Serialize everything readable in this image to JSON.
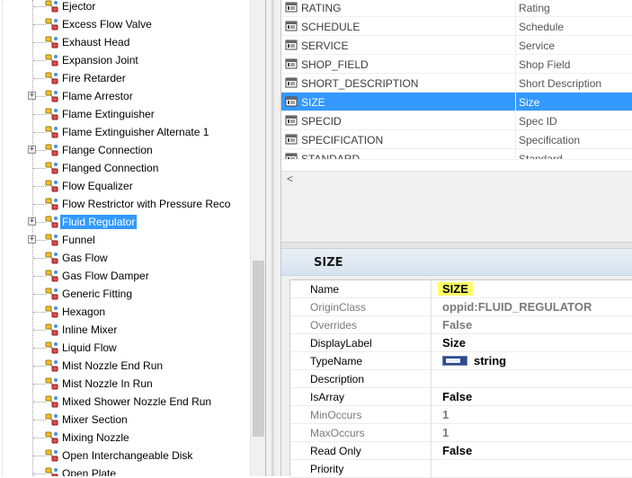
{
  "tree": {
    "items": [
      {
        "label": "Ejector",
        "expandable": false,
        "selected": false
      },
      {
        "label": "Excess Flow Valve",
        "expandable": false,
        "selected": false
      },
      {
        "label": "Exhaust Head",
        "expandable": false,
        "selected": false
      },
      {
        "label": "Expansion Joint",
        "expandable": false,
        "selected": false
      },
      {
        "label": "Fire Retarder",
        "expandable": false,
        "selected": false
      },
      {
        "label": "Flame Arrestor",
        "expandable": true,
        "selected": false
      },
      {
        "label": "Flame Extinguisher",
        "expandable": false,
        "selected": false
      },
      {
        "label": "Flame Extinguisher Alternate 1",
        "expandable": false,
        "selected": false
      },
      {
        "label": "Flange Connection",
        "expandable": true,
        "selected": false
      },
      {
        "label": "Flanged Connection",
        "expandable": false,
        "selected": false
      },
      {
        "label": "Flow Equalizer",
        "expandable": false,
        "selected": false
      },
      {
        "label": "Flow Restrictor with Pressure Reco",
        "expandable": false,
        "selected": false
      },
      {
        "label": "Fluid Regulator",
        "expandable": true,
        "selected": true
      },
      {
        "label": "Funnel",
        "expandable": true,
        "selected": false
      },
      {
        "label": "Gas Flow",
        "expandable": false,
        "selected": false
      },
      {
        "label": "Gas Flow Damper",
        "expandable": false,
        "selected": false
      },
      {
        "label": "Generic Fitting",
        "expandable": false,
        "selected": false
      },
      {
        "label": "Hexagon",
        "expandable": false,
        "selected": false
      },
      {
        "label": "Inline Mixer",
        "expandable": false,
        "selected": false
      },
      {
        "label": "Liquid Flow",
        "expandable": false,
        "selected": false
      },
      {
        "label": "Mist Nozzle End Run",
        "expandable": false,
        "selected": false
      },
      {
        "label": "Mist Nozzle In Run",
        "expandable": false,
        "selected": false
      },
      {
        "label": "Mixed Shower Nozzle End Run",
        "expandable": false,
        "selected": false
      },
      {
        "label": "Mixer Section",
        "expandable": false,
        "selected": false
      },
      {
        "label": "Mixing Nozzle",
        "expandable": false,
        "selected": false
      },
      {
        "label": "Open Interchangeable Disk",
        "expandable": false,
        "selected": false
      },
      {
        "label": "Open Plate",
        "expandable": false,
        "selected": false
      }
    ]
  },
  "properties": {
    "rows": [
      {
        "name": "RATING",
        "display": "Rating",
        "selected": false
      },
      {
        "name": "SCHEDULE",
        "display": "Schedule",
        "selected": false
      },
      {
        "name": "SERVICE",
        "display": "Service",
        "selected": false
      },
      {
        "name": "SHOP_FIELD",
        "display": "Shop Field",
        "selected": false
      },
      {
        "name": "SHORT_DESCRIPTION",
        "display": "Short Description",
        "selected": false
      },
      {
        "name": "SIZE",
        "display": "Size",
        "selected": true
      },
      {
        "name": "SPECID",
        "display": "Spec ID",
        "selected": false
      },
      {
        "name": "SPECIFICATION",
        "display": "Specification",
        "selected": false
      },
      {
        "name": "STANDARD",
        "display": "Standard",
        "selected": false
      }
    ],
    "scroll_left_arrow": "<"
  },
  "details": {
    "title": "SIZE",
    "rows": [
      {
        "name": "Name",
        "value": "SIZE",
        "dim": false,
        "highlight": true
      },
      {
        "name": "OriginClass",
        "value": "oppid:FLUID_REGULATOR",
        "dim": true
      },
      {
        "name": "Overrides",
        "value": "False",
        "dim": true
      },
      {
        "name": "DisplayLabel",
        "value": "Size",
        "dim": false
      },
      {
        "name": "TypeName",
        "value": "string",
        "dim": false,
        "type_icon": true
      },
      {
        "name": "Description",
        "value": "",
        "dim": false
      },
      {
        "name": "IsArray",
        "value": "False",
        "dim": false
      },
      {
        "name": "MinOccurs",
        "value": "1",
        "dim": true
      },
      {
        "name": "MaxOccurs",
        "value": "1",
        "dim": true
      },
      {
        "name": "Read Only",
        "value": "False",
        "dim": false
      },
      {
        "name": "Priority",
        "value": "",
        "dim": false
      }
    ]
  }
}
